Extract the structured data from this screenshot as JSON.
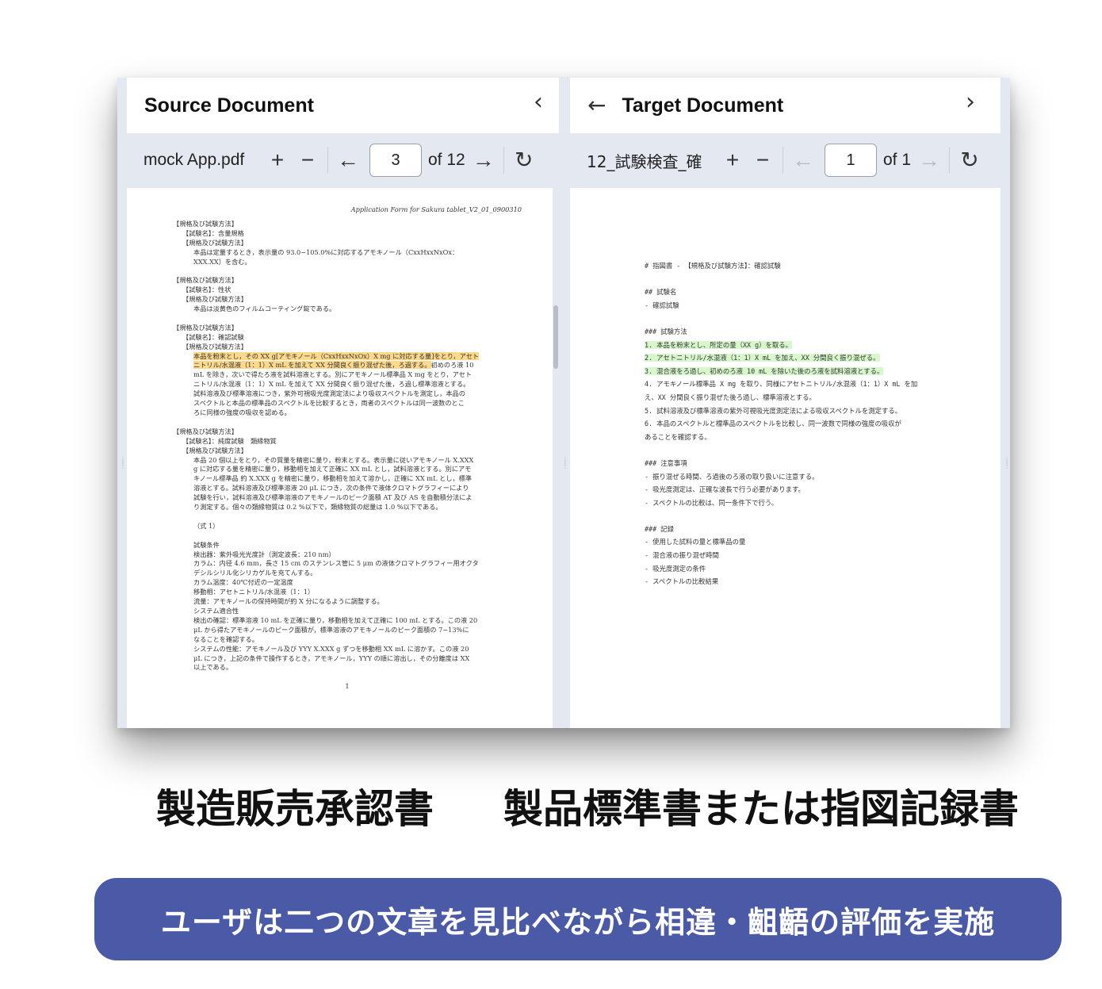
{
  "source_panel": {
    "title": "Source Document",
    "file_name": "mock App.pdf",
    "current_page": "3",
    "page_count_label": "of 12",
    "document": {
      "header": "Application Form for Sakura tablet_V2_01_0900310",
      "lines": [
        {
          "text": "【規格及び試験方法】",
          "indent": 0
        },
        {
          "text": "【試験名】：含量規格",
          "indent": 1
        },
        {
          "text": "【規格及び試験方法】",
          "indent": 1
        },
        {
          "text": "本品は定量するとき，表示量の 93.0~105.0%に対応するアモキノール（CxxHxxNxOx：",
          "indent": 2
        },
        {
          "text": "XXX.XX）を含む。",
          "indent": 2
        },
        {
          "text": "",
          "indent": 0
        },
        {
          "text": "【規格及び試験方法】",
          "indent": 0
        },
        {
          "text": "【試験名】：性状",
          "indent": 1
        },
        {
          "text": "【規格及び試験方法】",
          "indent": 1
        },
        {
          "text": "本品は淡黄色のフィルムコーティング錠である。",
          "indent": 2
        },
        {
          "text": "",
          "indent": 0
        },
        {
          "text": "【規格及び試験方法】",
          "indent": 0
        },
        {
          "text": "【試験名】：確認試験",
          "indent": 1
        },
        {
          "text": "【規格及び試験方法】",
          "indent": 1
        },
        {
          "text": "本品を粉末とし，その XX g[アモキノール（CxxHxxNxOx）X mg に対応する量]をとり，アセト",
          "indent": 2,
          "highlight": true
        },
        {
          "text": "ニトリル/水混液（1：1）X mL を加えて XX 分間良く振り混ぜた後，ろ過する。初めのろ液 10",
          "indent": 2,
          "highlight_partial": "ニトリル/水混液（1：1）X mL を加えて XX 分間良く振り混ぜた後，ろ過する。"
        },
        {
          "text": "mL を除き，次いで得たろ液を試料溶液とする。別にアモキノール標準品 X mg をとり，アセト",
          "indent": 2
        },
        {
          "text": "ニトリル/水混液（1：1）X mL を加えて XX 分間良く振り混ぜた後，ろ過し標準溶液とする。",
          "indent": 2
        },
        {
          "text": "試料溶液及び標準溶液につき，紫外可視吸光度測定法により吸収スペクトルを測定し，本品の",
          "indent": 2
        },
        {
          "text": "スペクトルと本品の標準品のスペクトルを比較するとき，両者のスペクトルは同一波数のとこ",
          "indent": 2
        },
        {
          "text": "ろに同様の強度の吸収を認める。",
          "indent": 2
        },
        {
          "text": "",
          "indent": 0
        },
        {
          "text": "【規格及び試験方法】",
          "indent": 0
        },
        {
          "text": "【試験名】：純度試験　類縁物質",
          "indent": 1
        },
        {
          "text": "【規格及び試験方法】",
          "indent": 1
        },
        {
          "text": "本品 20 個以上をとり，その質量を精密に量り，粉末とする。表示量に従いアモキノール X.XXX",
          "indent": 2
        },
        {
          "text": "g に対応する量を精密に量り，移動相を加えて正確に XX mL とし，試料溶液とする。別にアモ",
          "indent": 2
        },
        {
          "text": "キノール標準品 約 X.XXX g を精密に量り，移動相を加えて溶かし，正確に XX mL とし，標準",
          "indent": 2
        },
        {
          "text": "溶液とする。試料溶液及び標準溶液 20 μL につき，次の条件で液体クロマトグラフィーにより",
          "indent": 2
        },
        {
          "text": "試験を行い，試料溶液及び標準溶液のアモキノールのピーク面積 AT 及び AS を自動積分法によ",
          "indent": 2
        },
        {
          "text": "り測定する。個々の類縁物質は 0.2 %以下で，類縁物質の総量は 1.0 %以下である。",
          "indent": 2
        },
        {
          "text": "",
          "indent": 0
        },
        {
          "text": "（式 1）",
          "indent": 2
        },
        {
          "text": "",
          "indent": 0
        },
        {
          "text": "試験条件",
          "indent": 2
        },
        {
          "text": "検出器：紫外吸光光度計（測定波長：210 nm）",
          "indent": 2
        },
        {
          "text": "カラム：内径 4.6 mm，長さ 15 cm のステンレス管に 5 μm の液体クロマトグラフィー用オクタ",
          "indent": 2
        },
        {
          "text": "デシルシリル化シリカゲルを充てんする。",
          "indent": 2
        },
        {
          "text": "カラム温度：40℃付近の一定温度",
          "indent": 2
        },
        {
          "text": "移動相：アセトニトリル/水混液（1：1）",
          "indent": 2
        },
        {
          "text": "流量：アモキノールの保持時間が約 X 分になるように調整する。",
          "indent": 2
        },
        {
          "text": "システム適合性",
          "indent": 2
        },
        {
          "text": "検出の確認：標準溶液 10 mL を正確に量り，移動相を加えて正確に 100 mL とする。この液 20",
          "indent": 2
        },
        {
          "text": "μL から得たアモキノールのピーク面積が，標準溶液のアモキノールのピーク面積の 7~13%に",
          "indent": 2
        },
        {
          "text": "なることを確認する。",
          "indent": 2
        },
        {
          "text": "システムの性能：アモキノール及び YYY X.XXX g ずつを移動相 XX mL に溶かす。この液 20",
          "indent": 2
        },
        {
          "text": "μL につき，上記の条件で操作するとき，アモキノール，YYY の順に溶出し，その分離度は XX",
          "indent": 2
        },
        {
          "text": "以上である。",
          "indent": 2
        }
      ],
      "page_number": "1"
    }
  },
  "target_panel": {
    "title": "Target Document",
    "file_name": "12_試験検査_確",
    "current_page": "1",
    "page_count_label": "of 1",
    "document": {
      "lines": [
        {
          "text": "# 指図書 - 【規格及び試験方法】：確認試験"
        },
        {
          "text": ""
        },
        {
          "text": "## 試験名"
        },
        {
          "text": "- 確認試験"
        },
        {
          "text": ""
        },
        {
          "text": "### 試験方法"
        },
        {
          "text": "1. 本品を粉末とし、所定の量（XX g）を取る。",
          "highlight": true
        },
        {
          "text": "2. アセトニトリル/水混液（1：1）X mL を加え、XX 分間良く振り混ぜる。",
          "highlight": true
        },
        {
          "text": "3. 混合液をろ過し、初めのろ液 10 mL を除いた後のろ液を試料溶液とする。",
          "highlight": true
        },
        {
          "text": "4. アモキノール標準品 X mg を取り、同様にアセトニトリル/水混液（1：1）X mL を加"
        },
        {
          "text": "え、XX 分間良く振り混ぜた後ろ過し、標準溶液とする。"
        },
        {
          "text": "5. 試料溶液及び標準溶液の紫外可視吸光度測定法による吸収スペクトルを測定する。"
        },
        {
          "text": "6. 本品のスペクトルと標準品のスペクトルを比較し、同一波数で同様の強度の吸収が"
        },
        {
          "text": "あることを確認する。"
        },
        {
          "text": ""
        },
        {
          "text": "### 注意事項"
        },
        {
          "text": "- 振り混ぜる時間、ろ過後のろ液の取り扱いに注意する。"
        },
        {
          "text": "- 吸光度測定は、正確な波長で行う必要があります。"
        },
        {
          "text": "- スペクトルの比較は、同一条件下で行う。"
        },
        {
          "text": ""
        },
        {
          "text": "### 記録"
        },
        {
          "text": "- 使用した試料の量と標準品の量"
        },
        {
          "text": "- 混合液の振り混ぜ時間"
        },
        {
          "text": "- 吸光度測定の条件"
        },
        {
          "text": "- スペクトルの比較結果"
        }
      ]
    }
  },
  "captions": {
    "left": "製造販売承認書",
    "right": "製品標準書または指図記録書"
  },
  "banner": {
    "text": "ユーザは二つの文章を見比べながら相違・齟齬の評価を実施"
  },
  "colors": {
    "banner_bg": "#4a5aa6",
    "source_highlight": "#fbd88a",
    "target_highlight": "#d8f7cc",
    "frame_bg": "#e4e9f1"
  },
  "icons": {
    "collapse": "chevron-left-icon",
    "expand": "chevron-right-icon",
    "back": "arrow-left-icon",
    "zoom_in": "plus-icon",
    "zoom_out": "minus-icon",
    "prev_page": "arrow-left-icon",
    "next_page": "arrow-right-icon",
    "rotate": "refresh-icon"
  }
}
